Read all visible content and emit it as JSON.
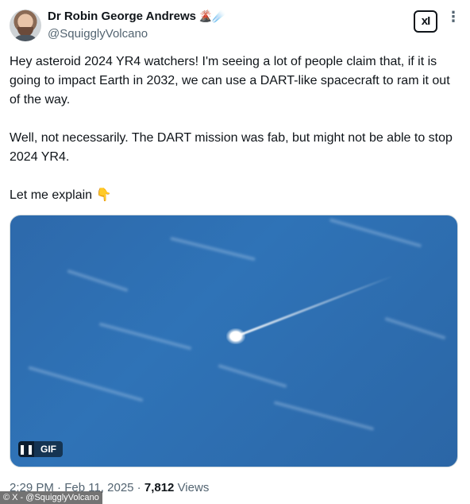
{
  "author": {
    "display_name": "Dr Robin George Andrews",
    "name_emojis": "🌋☄️",
    "handle": "@SquigglyVolcano"
  },
  "header_icons": {
    "logo_text": "xI",
    "more_glyph": "⋮"
  },
  "tweet": {
    "paragraph1": "Hey asteroid 2024 YR4 watchers! I'm seeing a lot of people claim that, if it is going to impact Earth in 2032, we can use a DART-like spacecraft to ram it out of the way.",
    "paragraph2": "Well, not necessarily. The DART mission was fab, but might not be able to stop 2024 YR4.",
    "paragraph3": "Let me explain 👇"
  },
  "media": {
    "pause_glyph": "❚❚",
    "badge": "GIF"
  },
  "meta": {
    "time": "2:29 PM",
    "sep1": " · ",
    "date": "Feb 11, 2025",
    "sep2": " · ",
    "views": "7,812",
    "views_label": " Views"
  },
  "watermark": "© X - @SquigglyVolcano",
  "colors": {
    "text": "#0f1419",
    "muted": "#536471",
    "media_blue": "#2f73b7"
  }
}
